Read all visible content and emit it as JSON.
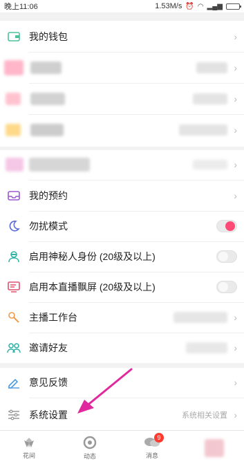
{
  "status_bar": {
    "time": "晚上11:06",
    "speed": "1.53M/s"
  },
  "menu": {
    "wallet": "我的钱包",
    "reservation": "我的预约",
    "dnd": "勿扰模式",
    "mystery": "启用神秘人身份 (20级及以上)",
    "float_screen": "启用本直播飘屏 (20级及以上)",
    "studio": "主播工作台",
    "invite": "邀请好友",
    "feedback": "意见反馈",
    "settings": "系统设置",
    "settings_value": "系统相关设置"
  },
  "toggles": {
    "dnd": true,
    "mystery": false,
    "float_screen": false
  },
  "bottom_tabs": {
    "huajian": "花间",
    "dongtai": "动态",
    "xiaoxi": "消息",
    "xiaoxi_badge": "9"
  },
  "colors": {
    "accent": "#ff4a76",
    "arrow": "#e0299c"
  }
}
